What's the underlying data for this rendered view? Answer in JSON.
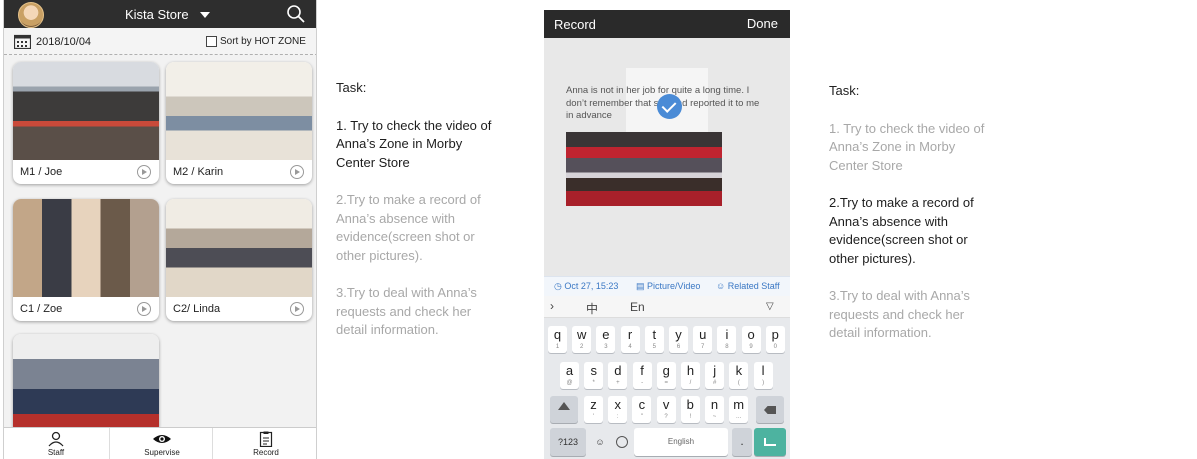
{
  "phone1": {
    "store_name": "Kista Store",
    "date": "2018/10/04",
    "sort_label": "Sort by HOT ZONE",
    "cards": [
      {
        "label": "M1 / Joe"
      },
      {
        "label": "M2 / Karin"
      },
      {
        "label": "C1 / Zoe"
      },
      {
        "label": "C2/ Linda"
      },
      {
        "label": ""
      }
    ],
    "tabs": [
      {
        "label": "Staff",
        "icon": "person-icon"
      },
      {
        "label": "Supervise",
        "icon": "eye-icon"
      },
      {
        "label": "Record",
        "icon": "clipboard-icon"
      }
    ]
  },
  "task_left": {
    "heading": "Task:",
    "items": [
      "1. Try to check the video of Anna’s Zone in Morby Center Store",
      "2.Try to make a record of Anna’s absence with evidence(screen shot or other pictures).",
      "3.Try to deal with Anna’s requests and check her detail information."
    ]
  },
  "task_right": {
    "heading": "Task:",
    "items": [
      "1. Try to check the video of Anna’s Zone in Morby Center Store",
      "2.Try to make a record of Anna’s absence with evidence(screen shot or other pictures).",
      "3.Try to deal with Anna’s requests and check her detail information."
    ]
  },
  "phone2": {
    "title": "Record",
    "done": "Done",
    "note": "Anna is not in her job for quite a long time. I don’t remember that she had reported it to me in advance",
    "toolbar": {
      "time": "Oct 27, 15:23",
      "picture": "Picture/Video",
      "staff": "Related Staff"
    },
    "keyboard": {
      "lang_zh": "中",
      "lang_en": "En",
      "row1": [
        [
          "q",
          "1"
        ],
        [
          "w",
          "2"
        ],
        [
          "e",
          "3"
        ],
        [
          "r",
          "4"
        ],
        [
          "t",
          "5"
        ],
        [
          "y",
          "6"
        ],
        [
          "u",
          "7"
        ],
        [
          "i",
          "8"
        ],
        [
          "o",
          "9"
        ],
        [
          "p",
          "0"
        ]
      ],
      "row2": [
        [
          "a",
          "@"
        ],
        [
          "s",
          "*"
        ],
        [
          "d",
          "+"
        ],
        [
          "f",
          "-"
        ],
        [
          "g",
          "="
        ],
        [
          "h",
          "/"
        ],
        [
          "j",
          "#"
        ],
        [
          "k",
          "("
        ],
        [
          "l",
          ")"
        ]
      ],
      "row3": [
        [
          "z",
          "'"
        ],
        [
          "x",
          ":"
        ],
        [
          "c",
          "\""
        ],
        [
          "v",
          "?"
        ],
        [
          "b",
          "!"
        ],
        [
          "n",
          "~"
        ],
        [
          "m",
          "…"
        ]
      ],
      "key_123": "?123",
      "space": "English",
      "period": "."
    }
  },
  "colors": {
    "topbar": "#2e2e2e",
    "accent_blue": "#3b78c4",
    "enter_key": "#4db3a0",
    "task_active": "#1d1d1d",
    "task_inactive": "#a8a8a8"
  }
}
